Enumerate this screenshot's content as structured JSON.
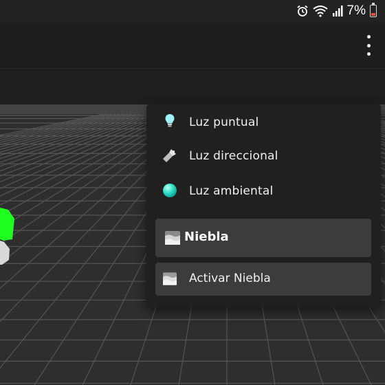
{
  "status_bar": {
    "battery_percent": "7%",
    "icons": [
      "alarm-icon",
      "wifi-icon",
      "signal-icon",
      "battery-icon"
    ],
    "battery_color": "#e0523a"
  },
  "app_bar": {
    "overflow_icon": "more-vert-icon"
  },
  "menu": {
    "items": [
      {
        "label": "Luz puntual",
        "icon": "lightbulb-icon"
      },
      {
        "label": "Luz direccional",
        "icon": "flashlight-icon"
      },
      {
        "label": "Luz ambiental",
        "icon": "sphere-icon"
      }
    ],
    "section": {
      "label": "Niebla",
      "icon": "fog-icon"
    },
    "fog_toggle": {
      "label": "Activar Niebla",
      "icon": "fog-icon"
    }
  },
  "scene": {
    "accent_green": "#1fff1f",
    "grid_color": "#555555"
  }
}
